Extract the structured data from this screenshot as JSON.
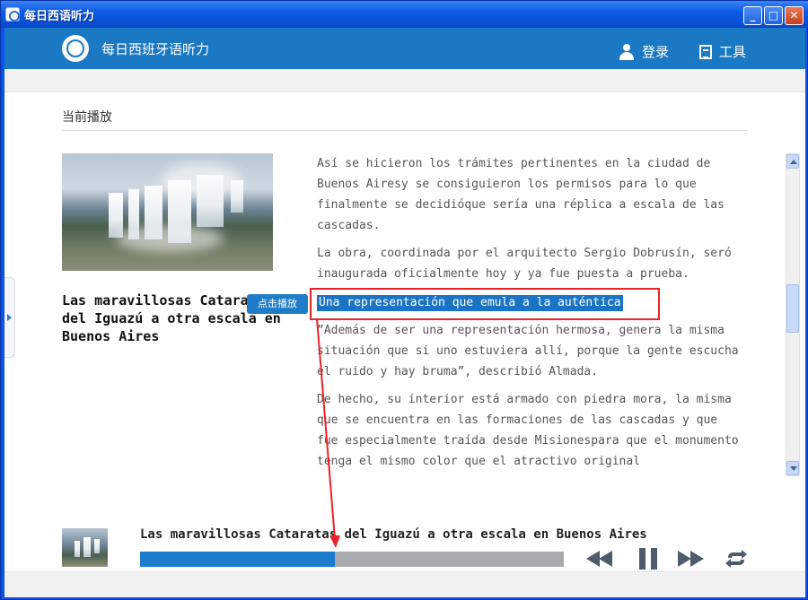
{
  "window": {
    "title": "每日西语听力",
    "minimize_label": "_",
    "maximize_label": "□",
    "close_label": "✕"
  },
  "header": {
    "app_name": "每日西班牙语听力",
    "login_label": "登录",
    "tools_label": "工具",
    "accent_color": "#1b78c3"
  },
  "section": {
    "title": "当前播放"
  },
  "article": {
    "title": "Las maravillosas Cataratas del Iguazú a otra escala en Buenos Aires",
    "play_tooltip": "点击播放",
    "paragraphs": [
      "Así se hicieron los trámites pertinentes en la ciudad de Buenos Airesy se consiguieron los permisos para lo que finalmente se decidióque sería una réplica a escala de las cascadas.",
      "La obra, coordinada por el arquitecto Sergio Dobrusín, seró inaugurada oficialmente hoy y ya fue puesta a prueba.",
      "Una representación que emula a la auténtica",
      "”Además de ser una representación hermosa, genera la misma situación que si uno estuviera allí, porque la gente escucha el ruido y hay bruma”, describió Almada.",
      "De hecho, su interior está armado con piedra mora, la misma que se encuentra en las formaciones de las cascadas y que fue especialmente traída desde Misionespara que el monumento tenga el mismo color que el atractivo original"
    ],
    "highlight_color": "#1b73c4"
  },
  "player": {
    "title": "Las maravillosas Cataratas del Iguazú a otra escala en Buenos Aires",
    "progress": 0.46,
    "progress_color": "#1b7bcc"
  },
  "annotation": {
    "box_color": "#e8232a"
  }
}
